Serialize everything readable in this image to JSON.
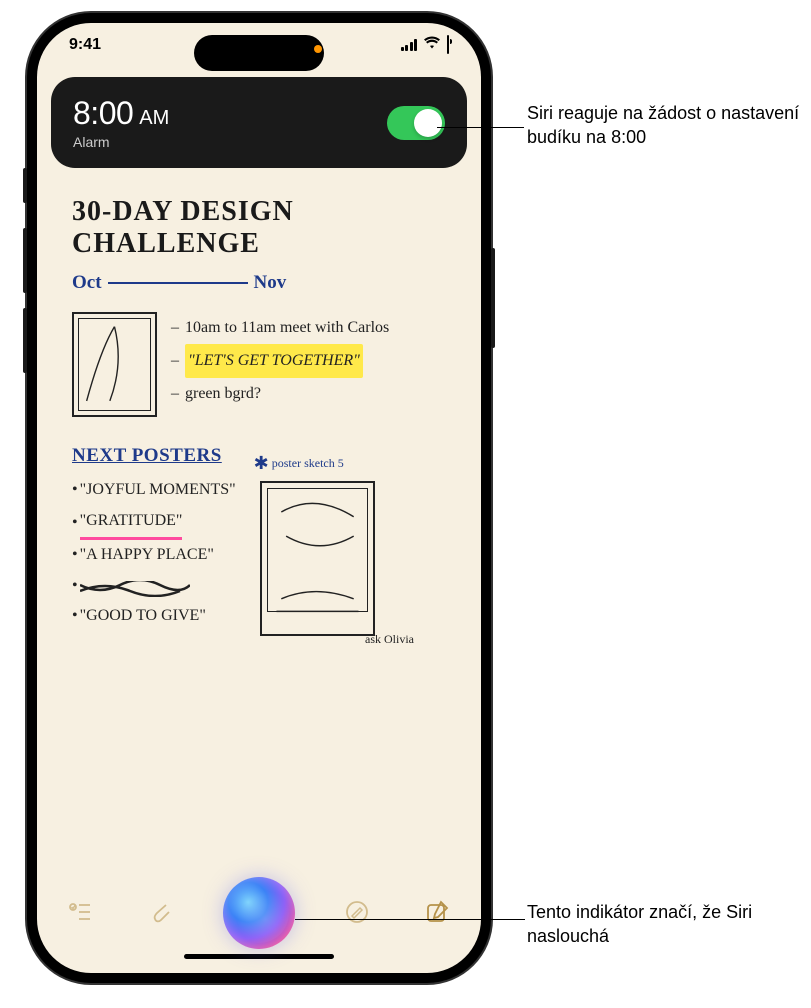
{
  "statusBar": {
    "time": "9:41"
  },
  "alarm": {
    "time": "8:00",
    "ampm": "AM",
    "label": "Alarm"
  },
  "note": {
    "titleLine1": "30-DAY DESIGN",
    "titleLine2": "CHALLENGE",
    "monthStart": "Oct",
    "monthEnd": "Nov",
    "bullet1": "10am to 11am meet with Carlos",
    "bullet2": "\"LET'S GET TOGETHER\"",
    "bullet3": "green bgrd?",
    "section": "NEXT POSTERS",
    "poster1": "\"JOYFUL MOMENTS\"",
    "poster2": "\"GRATITUDE\"",
    "poster3": "\"A HAPPY PLACE\"",
    "poster5": "\"GOOD TO GIVE\"",
    "askOlivia": "ask Olivia",
    "sketchLabel": "poster sketch 5"
  },
  "callouts": {
    "c1": "Siri reaguje na žádost o nastavení budíku na 8:00",
    "c2": "Tento indikátor značí, že Siri naslouchá"
  }
}
